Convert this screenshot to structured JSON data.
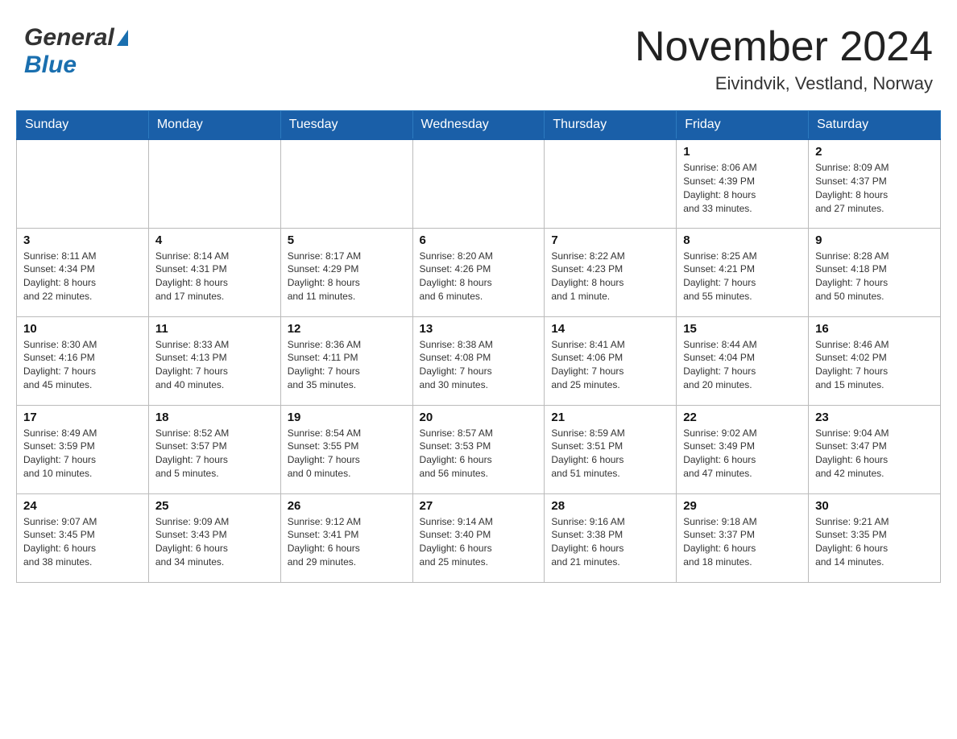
{
  "header": {
    "logo_general": "General",
    "logo_blue": "Blue",
    "month_title": "November 2024",
    "location": "Eivindvik, Vestland, Norway"
  },
  "weekdays": [
    "Sunday",
    "Monday",
    "Tuesday",
    "Wednesday",
    "Thursday",
    "Friday",
    "Saturday"
  ],
  "weeks": [
    [
      {
        "day": "",
        "info": ""
      },
      {
        "day": "",
        "info": ""
      },
      {
        "day": "",
        "info": ""
      },
      {
        "day": "",
        "info": ""
      },
      {
        "day": "",
        "info": ""
      },
      {
        "day": "1",
        "info": "Sunrise: 8:06 AM\nSunset: 4:39 PM\nDaylight: 8 hours\nand 33 minutes."
      },
      {
        "day": "2",
        "info": "Sunrise: 8:09 AM\nSunset: 4:37 PM\nDaylight: 8 hours\nand 27 minutes."
      }
    ],
    [
      {
        "day": "3",
        "info": "Sunrise: 8:11 AM\nSunset: 4:34 PM\nDaylight: 8 hours\nand 22 minutes."
      },
      {
        "day": "4",
        "info": "Sunrise: 8:14 AM\nSunset: 4:31 PM\nDaylight: 8 hours\nand 17 minutes."
      },
      {
        "day": "5",
        "info": "Sunrise: 8:17 AM\nSunset: 4:29 PM\nDaylight: 8 hours\nand 11 minutes."
      },
      {
        "day": "6",
        "info": "Sunrise: 8:20 AM\nSunset: 4:26 PM\nDaylight: 8 hours\nand 6 minutes."
      },
      {
        "day": "7",
        "info": "Sunrise: 8:22 AM\nSunset: 4:23 PM\nDaylight: 8 hours\nand 1 minute."
      },
      {
        "day": "8",
        "info": "Sunrise: 8:25 AM\nSunset: 4:21 PM\nDaylight: 7 hours\nand 55 minutes."
      },
      {
        "day": "9",
        "info": "Sunrise: 8:28 AM\nSunset: 4:18 PM\nDaylight: 7 hours\nand 50 minutes."
      }
    ],
    [
      {
        "day": "10",
        "info": "Sunrise: 8:30 AM\nSunset: 4:16 PM\nDaylight: 7 hours\nand 45 minutes."
      },
      {
        "day": "11",
        "info": "Sunrise: 8:33 AM\nSunset: 4:13 PM\nDaylight: 7 hours\nand 40 minutes."
      },
      {
        "day": "12",
        "info": "Sunrise: 8:36 AM\nSunset: 4:11 PM\nDaylight: 7 hours\nand 35 minutes."
      },
      {
        "day": "13",
        "info": "Sunrise: 8:38 AM\nSunset: 4:08 PM\nDaylight: 7 hours\nand 30 minutes."
      },
      {
        "day": "14",
        "info": "Sunrise: 8:41 AM\nSunset: 4:06 PM\nDaylight: 7 hours\nand 25 minutes."
      },
      {
        "day": "15",
        "info": "Sunrise: 8:44 AM\nSunset: 4:04 PM\nDaylight: 7 hours\nand 20 minutes."
      },
      {
        "day": "16",
        "info": "Sunrise: 8:46 AM\nSunset: 4:02 PM\nDaylight: 7 hours\nand 15 minutes."
      }
    ],
    [
      {
        "day": "17",
        "info": "Sunrise: 8:49 AM\nSunset: 3:59 PM\nDaylight: 7 hours\nand 10 minutes."
      },
      {
        "day": "18",
        "info": "Sunrise: 8:52 AM\nSunset: 3:57 PM\nDaylight: 7 hours\nand 5 minutes."
      },
      {
        "day": "19",
        "info": "Sunrise: 8:54 AM\nSunset: 3:55 PM\nDaylight: 7 hours\nand 0 minutes."
      },
      {
        "day": "20",
        "info": "Sunrise: 8:57 AM\nSunset: 3:53 PM\nDaylight: 6 hours\nand 56 minutes."
      },
      {
        "day": "21",
        "info": "Sunrise: 8:59 AM\nSunset: 3:51 PM\nDaylight: 6 hours\nand 51 minutes."
      },
      {
        "day": "22",
        "info": "Sunrise: 9:02 AM\nSunset: 3:49 PM\nDaylight: 6 hours\nand 47 minutes."
      },
      {
        "day": "23",
        "info": "Sunrise: 9:04 AM\nSunset: 3:47 PM\nDaylight: 6 hours\nand 42 minutes."
      }
    ],
    [
      {
        "day": "24",
        "info": "Sunrise: 9:07 AM\nSunset: 3:45 PM\nDaylight: 6 hours\nand 38 minutes."
      },
      {
        "day": "25",
        "info": "Sunrise: 9:09 AM\nSunset: 3:43 PM\nDaylight: 6 hours\nand 34 minutes."
      },
      {
        "day": "26",
        "info": "Sunrise: 9:12 AM\nSunset: 3:41 PM\nDaylight: 6 hours\nand 29 minutes."
      },
      {
        "day": "27",
        "info": "Sunrise: 9:14 AM\nSunset: 3:40 PM\nDaylight: 6 hours\nand 25 minutes."
      },
      {
        "day": "28",
        "info": "Sunrise: 9:16 AM\nSunset: 3:38 PM\nDaylight: 6 hours\nand 21 minutes."
      },
      {
        "day": "29",
        "info": "Sunrise: 9:18 AM\nSunset: 3:37 PM\nDaylight: 6 hours\nand 18 minutes."
      },
      {
        "day": "30",
        "info": "Sunrise: 9:21 AM\nSunset: 3:35 PM\nDaylight: 6 hours\nand 14 minutes."
      }
    ]
  ]
}
